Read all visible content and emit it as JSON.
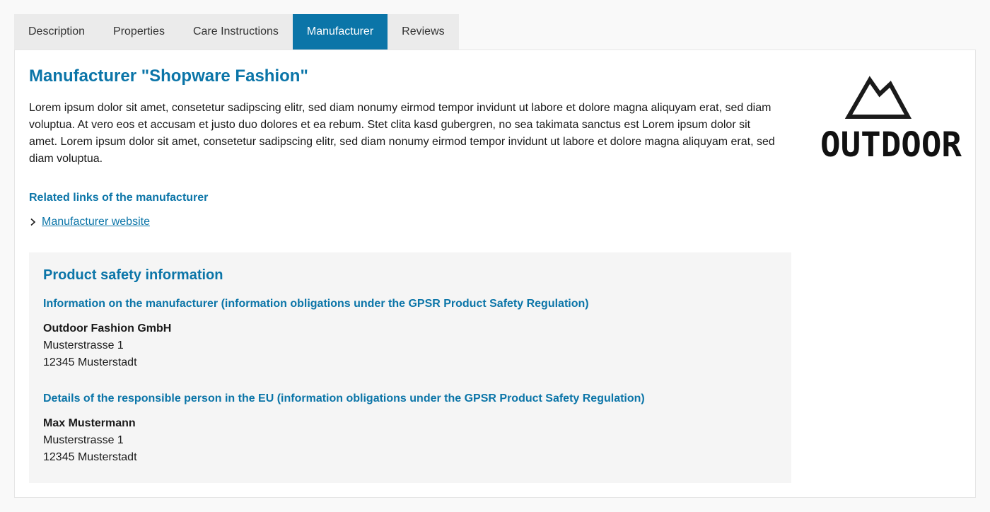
{
  "tabs": [
    {
      "label": "Description",
      "active": false
    },
    {
      "label": "Properties",
      "active": false
    },
    {
      "label": "Care Instructions",
      "active": false
    },
    {
      "label": "Manufacturer",
      "active": true
    },
    {
      "label": "Reviews",
      "active": false
    }
  ],
  "manufacturer": {
    "title": "Manufacturer \"Shopware Fashion\"",
    "description": "Lorem ipsum dolor sit amet, consetetur sadipscing elitr, sed diam nonumy eirmod tempor invidunt ut labore et dolore magna aliquyam erat, sed diam voluptua. At vero eos et accusam et justo duo dolores et ea rebum. Stet clita kasd gubergren, no sea takimata sanctus est Lorem ipsum dolor sit amet. Lorem ipsum dolor sit amet, consetetur sadipscing elitr, sed diam nonumy eirmod tempor invidunt ut labore et dolore magna aliquyam erat, sed diam voluptua.",
    "links_heading": "Related links of the manufacturer",
    "website_link": "Manufacturer website",
    "logo_text": "OUTDOOR"
  },
  "safety": {
    "title": "Product safety information",
    "manufacturer_heading": "Information on the manufacturer (information obligations under the GPSR Product Safety Regulation)",
    "manufacturer_name": "Outdoor Fashion GmbH",
    "manufacturer_street": "Musterstrasse 1",
    "manufacturer_city": "12345 Musterstadt",
    "eu_heading": "Details of the responsible person in the EU (information obligations under the GPSR Product Safety Regulation)",
    "eu_name": "Max Mustermann",
    "eu_street": "Musterstrasse 1",
    "eu_city": "12345 Musterstadt"
  },
  "colors": {
    "accent": "#0b75a8",
    "tab_bg": "#ebebeb",
    "safety_bg": "#f5f5f5"
  },
  "icons": {
    "link_chevron": "chevron-right-icon",
    "logo_mountain": "mountain-icon"
  }
}
